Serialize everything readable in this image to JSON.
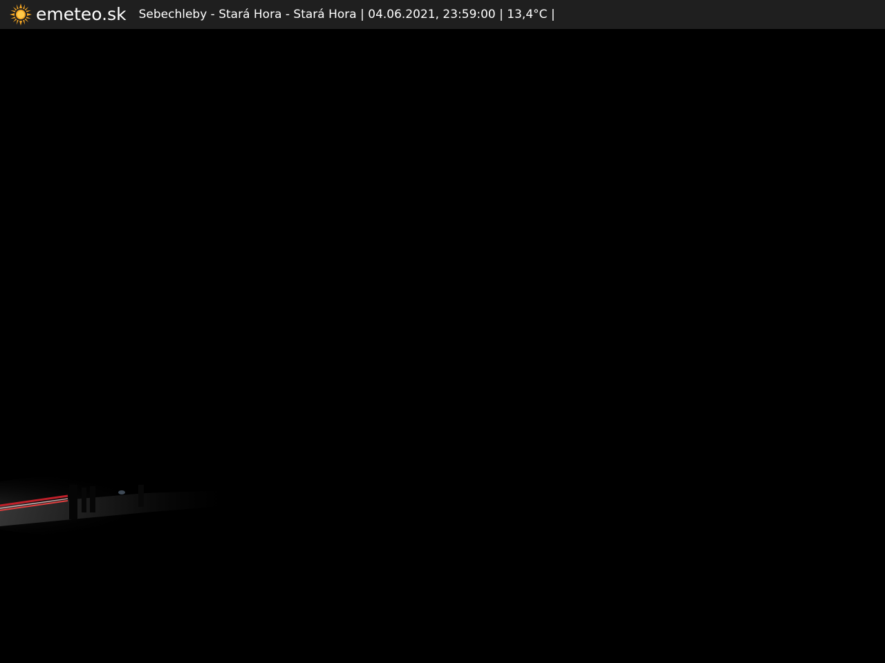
{
  "header": {
    "logo_text": "emeteo.sk",
    "logo_icon": "sun-icon",
    "location": "Sebechleby - Stará Hora - Stará Hora",
    "datetime": "04.06.2021, 23:59:00",
    "temperature": "13,4°C",
    "separator": "|"
  },
  "colors": {
    "header_bg": "#1f1f1f",
    "sun": "#f5a623",
    "background": "#000000"
  }
}
